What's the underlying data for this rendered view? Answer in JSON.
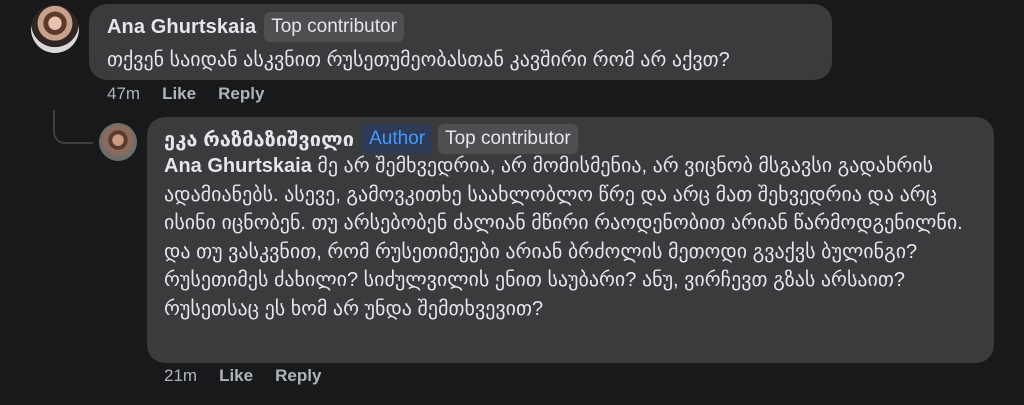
{
  "comments": [
    {
      "author": "Ana Ghurtskaia",
      "badges": [
        "Top contributor"
      ],
      "text": "თქვენ საიდან ასკვნით რუსეთუმეობასთან კავშირი რომ არ აქვთ?",
      "time": "47m",
      "like_label": "Like",
      "reply_label": "Reply"
    },
    {
      "author": "ეკა რაზმაზიშვილი",
      "badges": [
        "Author",
        "Top contributor"
      ],
      "mention": "Ana Ghurtskaia",
      "text": " მე არ შემხვედრია, არ მომისმენია, არ ვიცნობ მსგავსი გადახრის ადამიანებს. ასევე, გამოვკითხე საახლობლო წრე და არც მათ შეხვედრია და არც ისინი იცნობენ. თუ არსებობენ ძალიან მწირი რაოდენობით არიან წარმოდგენილნი. და თუ ვასკვნით, რომ რუსეთიმეები არიან ბრძოლის მეთოდი გვაქვს ბულინგი? რუსეთიმეს ძახილი? სიძულვილის ენით საუბარი? ანუ, ვირჩევთ გზას არსაით? რუსეთსაც ეს ხომ არ უნდა შემთხვევით?",
      "time": "21m",
      "like_label": "Like",
      "reply_label": "Reply"
    }
  ],
  "colors": {
    "background": "#18191a",
    "bubble": "#3a3b3c",
    "text": "#e4e6eb",
    "secondary_text": "#b0b3b8",
    "author_badge_text": "#4599ff"
  }
}
